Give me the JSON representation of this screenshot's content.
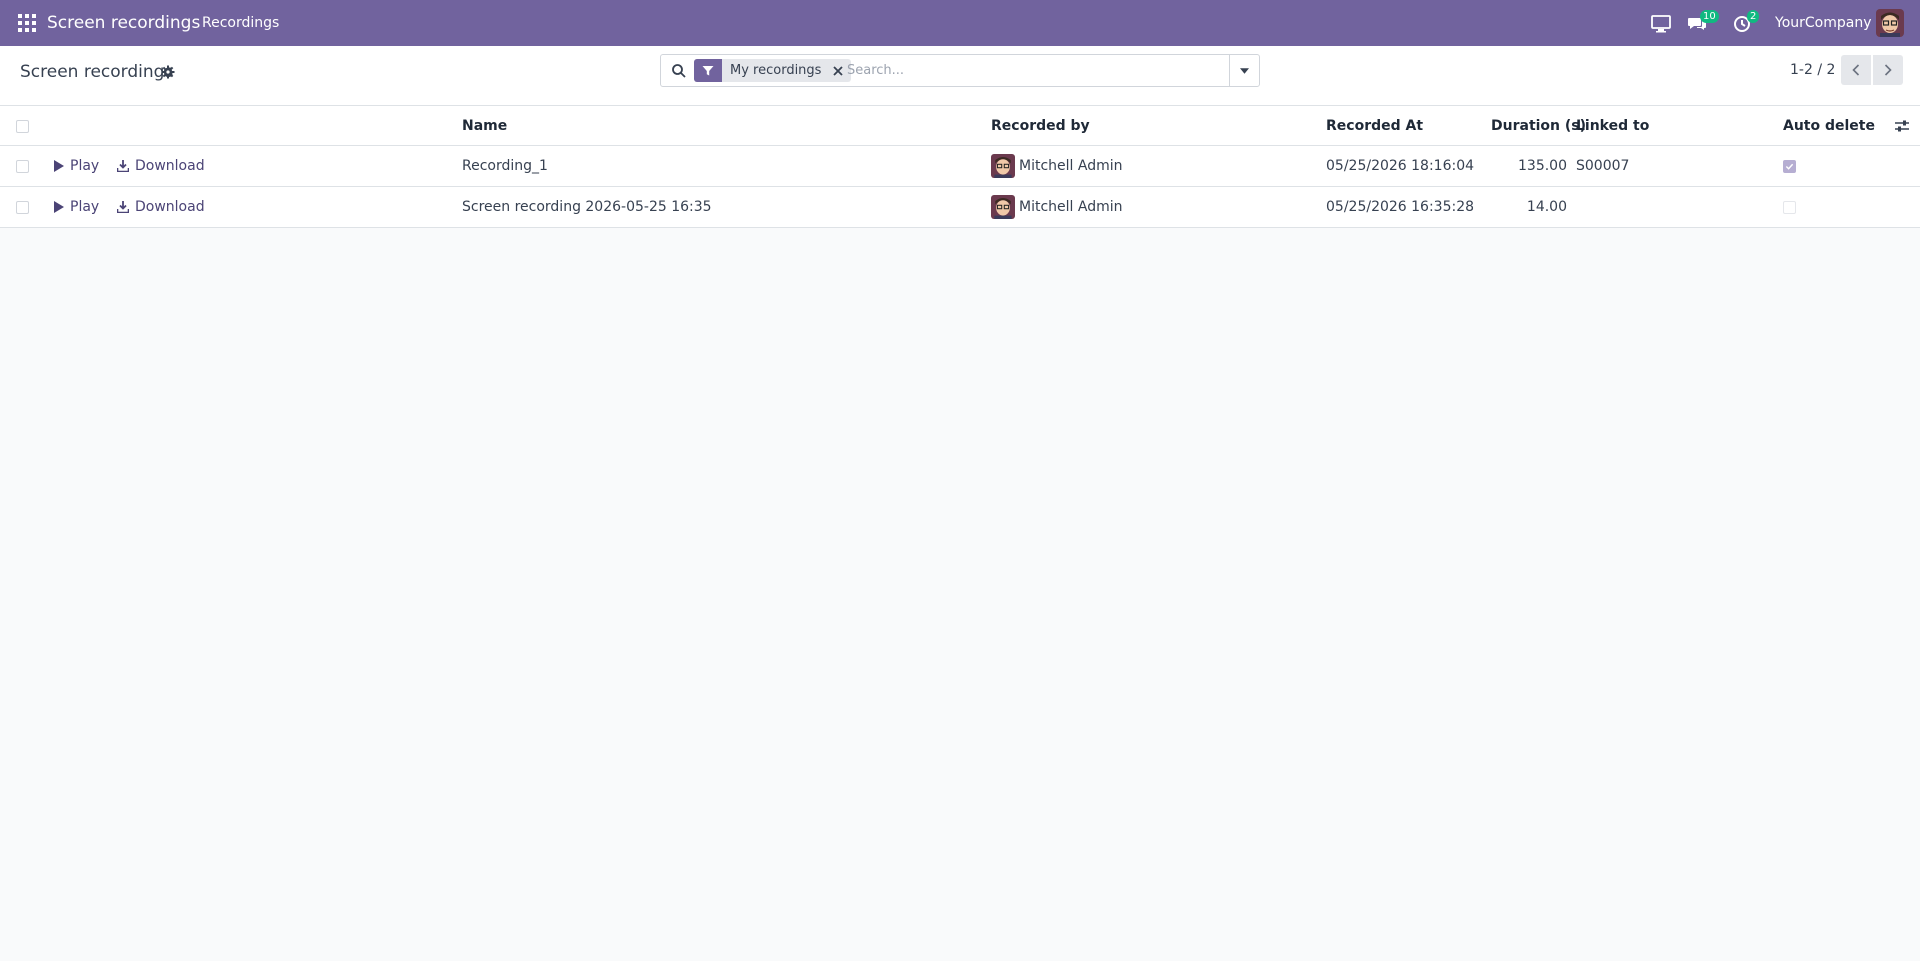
{
  "navbar": {
    "app_name": "Screen recordings",
    "menu_recordings": "Recordings",
    "messages_count": "10",
    "activities_count": "2",
    "company": "YourCompany"
  },
  "control_panel": {
    "title": "Screen recordings",
    "search_facet": "My recordings",
    "search_placeholder": "Search...",
    "pager": "1-2 / 2"
  },
  "table": {
    "headers": {
      "name": "Name",
      "recorded_by": "Recorded by",
      "recorded_at": "Recorded At",
      "duration": "Duration (s)",
      "linked_to": "Linked to",
      "auto_delete": "Auto delete"
    },
    "play_label": "Play",
    "download_label": "Download",
    "rows": [
      {
        "name": "Recording_1",
        "recorded_by": "Mitchell Admin",
        "recorded_at": "05/25/2026 18:16:04",
        "duration": "135.00",
        "linked_to": "S00007",
        "auto_delete": true
      },
      {
        "name": "Screen recording 2026-05-25 16:35",
        "recorded_by": "Mitchell Admin",
        "recorded_at": "05/25/2026 16:35:28",
        "duration": "14.00",
        "linked_to": "",
        "auto_delete": false
      }
    ]
  },
  "colors": {
    "navbar": "#71639e",
    "accent": "#71639e",
    "badge": "#10b981"
  }
}
